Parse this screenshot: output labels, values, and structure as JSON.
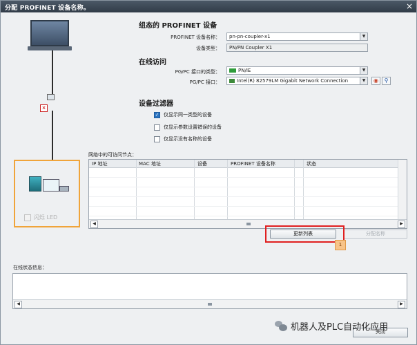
{
  "window": {
    "title": "分配 PROFINET 设备名称。",
    "close_icon": "×"
  },
  "left_pane": {
    "flash_led_label": "闪烁 LED"
  },
  "configured": {
    "section_title": "组态的 PROFINET 设备",
    "device_name_label": "PROFINET 设备名称：",
    "device_name_value": "pn-pn-coupler-x1",
    "device_type_label": "设备类型：",
    "device_type_value": "PN/PN Coupler X1"
  },
  "online_access": {
    "section_title": "在线访问",
    "pgpc_type_label": "PG/PC 接口的类型：",
    "pgpc_type_value": "PN/IE",
    "pgpc_interface_label": "PG/PC 接口：",
    "pgpc_interface_value": "Intel(R) 82579LM Gigabit Network Connection"
  },
  "filter": {
    "section_title": "设备过滤器",
    "options": [
      {
        "label": "仅显示同一类型的设备",
        "checked": true
      },
      {
        "label": "仅显示参数设置错误的设备",
        "checked": false
      },
      {
        "label": "仅显示没有名称的设备",
        "checked": false
      }
    ]
  },
  "nodes": {
    "label": "网络中的可访问节点：",
    "columns": [
      "IP 地址",
      "MAC 地址",
      "设备",
      "PROFINET 设备名称",
      "状态"
    ],
    "rows": []
  },
  "actions": {
    "update_list": "更新列表",
    "assign_name": "分配名称",
    "callout_number": "1"
  },
  "status": {
    "label": "在线状态信息："
  },
  "footer": {
    "close_label": "关闭"
  },
  "watermark": {
    "text": "机器人及PLC自动化应用"
  }
}
